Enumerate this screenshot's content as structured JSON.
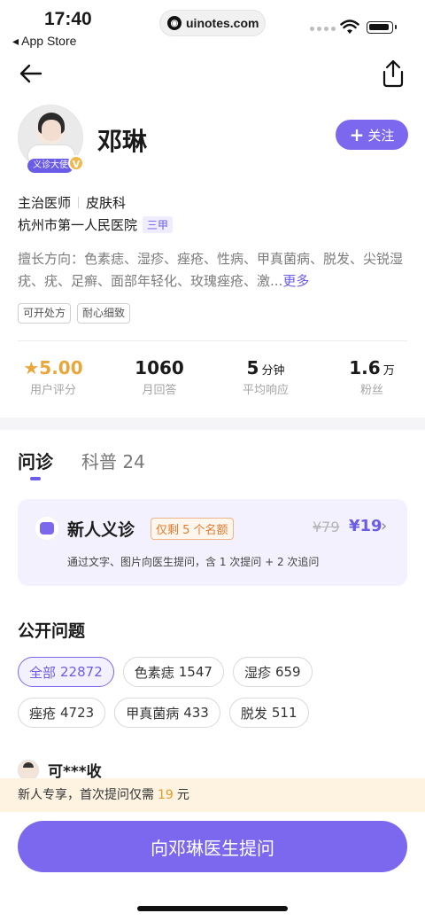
{
  "status_bar": {
    "time": "17:40",
    "back_app": "◂ App Store",
    "url": "uinotes.com"
  },
  "doctor": {
    "name": "邓琳",
    "avatar_tag": "义诊大使",
    "verified_badge": "V",
    "follow_label": "关注",
    "title": "主治医师",
    "department": "皮肤科",
    "hospital": "杭州市第一人民医院",
    "hospital_grade": "三甲",
    "specialty_text": "擅长方向：色素痣、湿疹、痤疮、性病、甲真菌病、脱发、尖锐湿疣、疣、足癣、面部年轻化、玫瑰痤疮、激...",
    "specialty_more": "更多",
    "tags": [
      "可开处方",
      "耐心细致"
    ]
  },
  "stats": [
    {
      "value": "5.00",
      "unit": "",
      "label": "用户评分"
    },
    {
      "value": "1060",
      "unit": "",
      "label": "月回答"
    },
    {
      "value": "5",
      "unit": "分钟",
      "label": "平均响应"
    },
    {
      "value": "1.6",
      "unit": "万",
      "label": "粉丝"
    }
  ],
  "tabs": [
    {
      "label": "问诊",
      "active": true
    },
    {
      "label": "科普 24",
      "active": false
    }
  ],
  "promo": {
    "title": "新人义诊",
    "limit": "仅剩 5 个名额",
    "original_price": "¥79",
    "price": "¥19",
    "description": "通过文字、图片向医生提问，含 1 次提问 + 2 次追问"
  },
  "questions": {
    "title": "公开问题",
    "filters": [
      {
        "label": "全部",
        "count": "22872",
        "active": true
      },
      {
        "label": "色素痣",
        "count": "1547",
        "active": false
      },
      {
        "label": "湿疹",
        "count": "659",
        "active": false
      },
      {
        "label": "痤疮",
        "count": "4723",
        "active": false
      },
      {
        "label": "甲真菌病",
        "count": "433",
        "active": false
      },
      {
        "label": "脱发",
        "count": "511",
        "active": false
      }
    ],
    "first_asker": "可***收"
  },
  "notice": {
    "prefix": "新人专享，首次提问仅需",
    "amount": "19",
    "suffix": "元"
  },
  "cta_label": "向邓琳医生提问",
  "colors": {
    "accent": "#7b68ee",
    "rating": "#e9a63a",
    "notice_bg": "#fdf3e0"
  }
}
